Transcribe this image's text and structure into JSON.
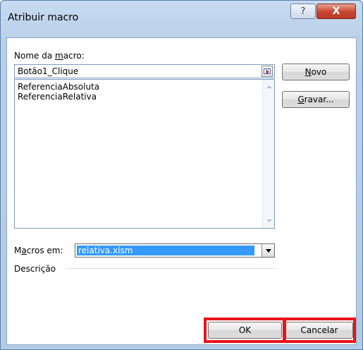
{
  "window": {
    "title": "Atribuir macro",
    "help_glyph": "?",
    "close_glyph": "X"
  },
  "macro_name": {
    "label_before": "Nome da ",
    "label_accel": "m",
    "label_after": "acro:",
    "value": "Botão1_Clique"
  },
  "macros": [
    "ReferenciaAbsoluta",
    "ReferenciaRelativa"
  ],
  "buttons": {
    "novo": {
      "accel": "N",
      "rest": "ovo"
    },
    "gravar": {
      "accel": "G",
      "rest": "ravar..."
    },
    "ok": "OK",
    "cancel": "Cancelar"
  },
  "macros_in": {
    "label_before": "M",
    "label_accel": "a",
    "label_after": "cros em:",
    "value": "relativa.xlsm"
  },
  "description": {
    "label": "Descrição"
  },
  "icons": {
    "help": "help-icon",
    "close": "close-icon",
    "collapse": "collapse-dialog-icon",
    "dropdown": "chevron-down-icon"
  },
  "colors": {
    "highlight_border": "#e8141c",
    "selection": "#3399ff"
  }
}
